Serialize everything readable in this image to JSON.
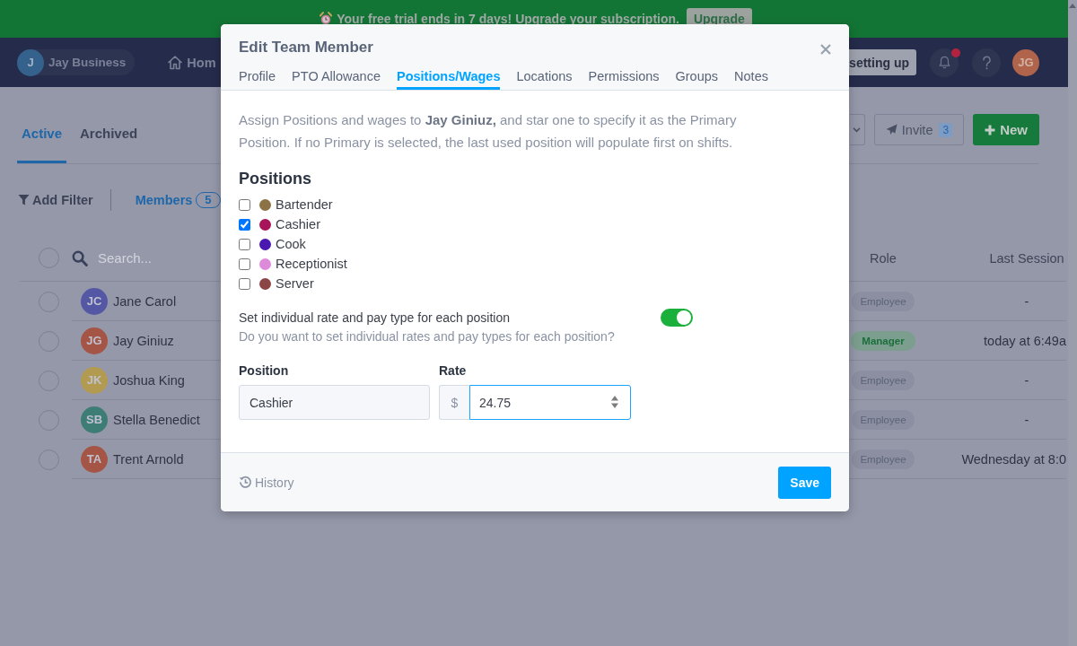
{
  "trial_banner": {
    "text": "Your free trial ends in 7 days! Upgrade your subscription.",
    "button": "Upgrade"
  },
  "top_nav": {
    "workspace": {
      "initial": "J",
      "name": "Jay Business"
    },
    "home": "Hom",
    "setup_button": "setting up",
    "notifications": {
      "unread": true
    },
    "user_avatar": "JG"
  },
  "page": {
    "tabs": [
      {
        "label": "Active",
        "selected": true
      },
      {
        "label": "Archived",
        "selected": false
      }
    ],
    "invite": {
      "label": "Invite",
      "count": "3"
    },
    "new_button": "New",
    "filter": "Add Filter",
    "members": {
      "label": "Members",
      "count": "5"
    },
    "table": {
      "select_all": {
        "checked": false
      },
      "search_placeholder": "Search...",
      "columns": [
        "Role",
        "Last Session"
      ],
      "rows": [
        {
          "initials": "JC",
          "name": "Jane Carol",
          "color": "#5458a4",
          "selected": false,
          "role": {
            "label": "Employee",
            "kind": "default"
          },
          "last_session": "-"
        },
        {
          "initials": "JG",
          "name": "Jay Giniuz",
          "color": "#a45546",
          "selected": false,
          "role": {
            "label": "Manager",
            "kind": "success"
          },
          "last_session": "today at 6:49a"
        },
        {
          "initials": "JK",
          "name": "Joshua King",
          "color": "#b29a51",
          "selected": false,
          "role": {
            "label": "Employee",
            "kind": "default"
          },
          "last_session": "-"
        },
        {
          "initials": "SB",
          "name": "Stella Benedict",
          "color": "#3e7d76",
          "selected": false,
          "role": {
            "label": "Employee",
            "kind": "default"
          },
          "last_session": "-"
        },
        {
          "initials": "TA",
          "name": "Trent Arnold",
          "color": "#a45546",
          "selected": false,
          "role": {
            "label": "Employee",
            "kind": "default"
          },
          "last_session": "Wednesday at 8:0"
        }
      ]
    }
  },
  "modal": {
    "title": "Edit Team Member",
    "tabs": [
      {
        "label": "Profile",
        "selected": false
      },
      {
        "label": "PTO Allowance",
        "selected": false
      },
      {
        "label": "Positions/Wages",
        "selected": true
      },
      {
        "label": "Locations",
        "selected": false
      },
      {
        "label": "Permissions",
        "selected": false
      },
      {
        "label": "Groups",
        "selected": false
      },
      {
        "label": "Notes",
        "selected": false
      }
    ],
    "intro": "Assign Positions and wages to **Jay Giniuz,** and star one to specify it as the Primary Position. If no Primary is selected, the last used position will populate first on shifts.",
    "positions_heading": "Positions",
    "positions": [
      {
        "name": "Bartender",
        "color": "#8b7346",
        "checked": false
      },
      {
        "name": "Cashier",
        "color": "#a8145a",
        "checked": true
      },
      {
        "name": "Cook",
        "color": "#4a17b0",
        "checked": false
      },
      {
        "name": "Receptionist",
        "color": "#de8adb",
        "checked": false
      },
      {
        "name": "Server",
        "color": "#8b4545",
        "checked": false
      }
    ],
    "individual_rates": {
      "label": "Set individual rate and pay type for each position",
      "hint": "Do you want to set individual rates and pay types for each position?",
      "on": true
    },
    "rate_form": {
      "position_label": "Position",
      "position_value": "Cashier",
      "rate_label": "Rate",
      "currency": "$",
      "rate_value": "24.75"
    },
    "history": "History",
    "save": "Save"
  }
}
